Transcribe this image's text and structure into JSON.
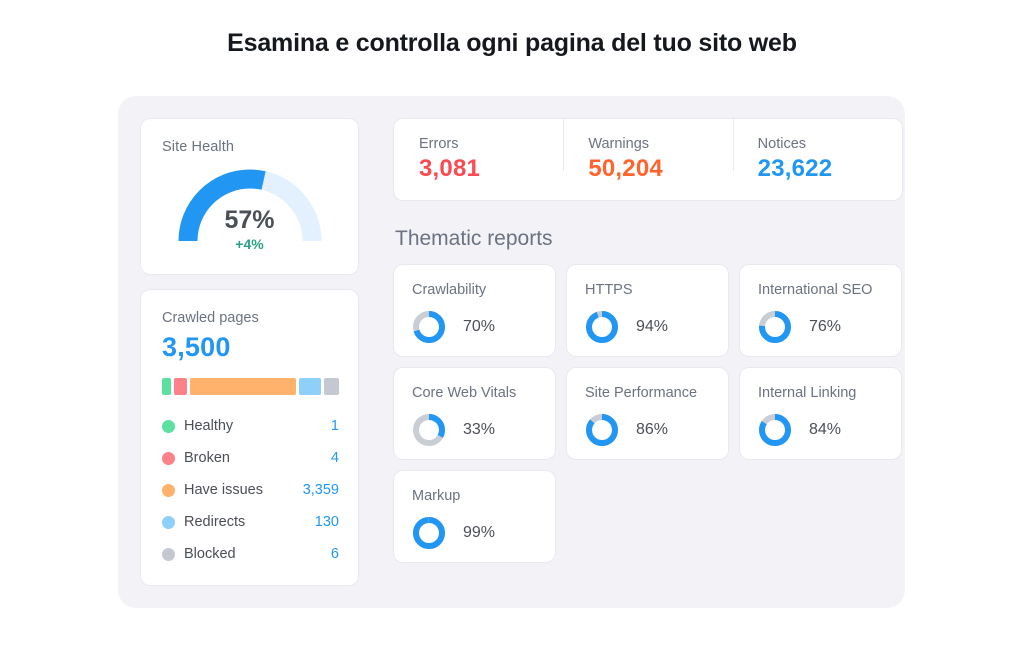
{
  "page": {
    "title": "Esamina e controlla ogni pagina del tuo sito web"
  },
  "colors": {
    "blue": "#2196f3",
    "blue_track": "#e2f1fd",
    "gray_track": "#c9cdd4",
    "red": "#fc4a53",
    "orange": "#ff642d",
    "green": "#2aa086",
    "healthy": "#5ce0a0",
    "broken": "#fc8189",
    "have_issues": "#ffb26b",
    "redirects": "#8fd0fb",
    "blocked": "#c4c8d0"
  },
  "site_health": {
    "label": "Site Health",
    "value": "57%",
    "percent": 57,
    "delta": "+4%"
  },
  "stats": [
    {
      "label": "Errors",
      "value": "3,081",
      "color": "#fc4a53"
    },
    {
      "label": "Warnings",
      "value": "50,204",
      "color": "#ff642d"
    },
    {
      "label": "Notices",
      "value": "23,622",
      "color": "#2196f3"
    }
  ],
  "crawled_pages": {
    "label": "Crawled pages",
    "total": "3,500",
    "segments": [
      {
        "name": "Healthy",
        "value": "1",
        "percent": 5.5,
        "color": "#5ce0a0"
      },
      {
        "name": "Broken",
        "value": "4",
        "percent": 7.5,
        "color": "#fc8189"
      },
      {
        "name": "Have issues",
        "value": "3,359",
        "percent": 62,
        "color": "#ffb26b"
      },
      {
        "name": "Redirects",
        "value": "130",
        "percent": 13,
        "color": "#8fd0fb"
      },
      {
        "name": "Blocked",
        "value": "6",
        "percent": 9,
        "color": "#c4c8d0"
      }
    ]
  },
  "thematic_reports": {
    "title": "Thematic reports",
    "cards": [
      {
        "name": "Crawlability",
        "value": "70%",
        "percent": 70
      },
      {
        "name": "HTTPS",
        "value": "94%",
        "percent": 94
      },
      {
        "name": "International SEO",
        "value": "76%",
        "percent": 76
      },
      {
        "name": "Core Web Vitals",
        "value": "33%",
        "percent": 33
      },
      {
        "name": "Site Performance",
        "value": "86%",
        "percent": 86
      },
      {
        "name": "Internal Linking",
        "value": "84%",
        "percent": 84
      },
      {
        "name": "Markup",
        "value": "99%",
        "percent": 99
      }
    ]
  }
}
